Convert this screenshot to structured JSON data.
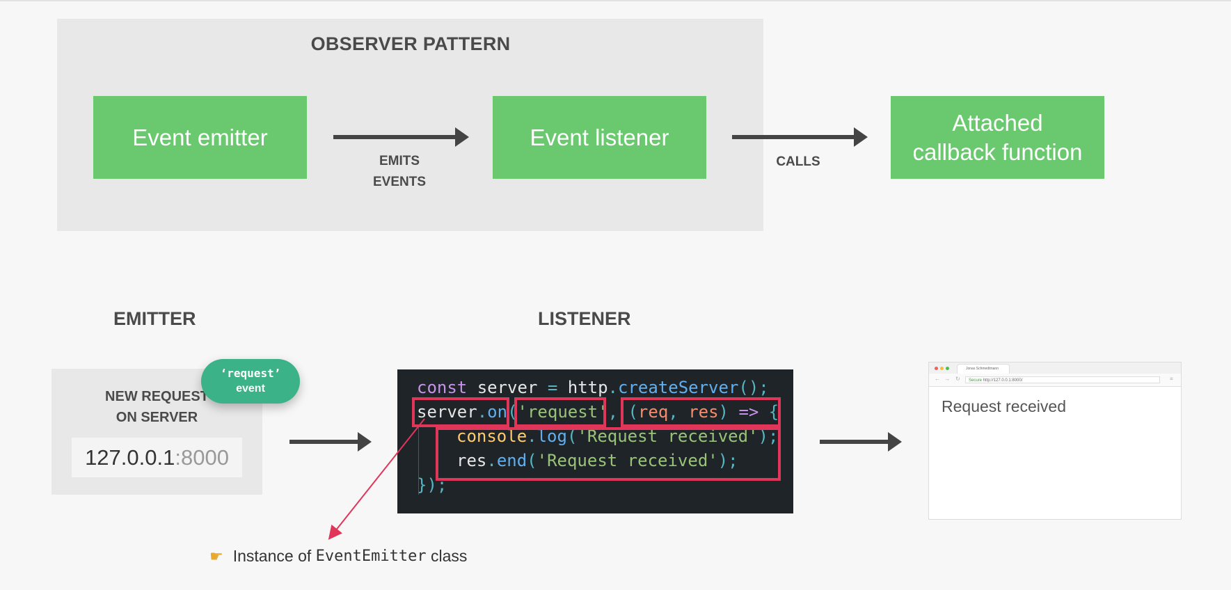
{
  "observer": {
    "title": "OBSERVER PATTERN",
    "emitter_box": "Event emitter",
    "listener_box": "Event listener",
    "callback_box_line1": "Attached",
    "callback_box_line2": "callback function",
    "emits_line1": "EMITS",
    "emits_line2": "EVENTS",
    "calls": "CALLS"
  },
  "emitter": {
    "heading": "EMITTER",
    "text_line1": "NEW REQUEST",
    "text_line2": "ON SERVER",
    "url_host": "127.0.0.1",
    "url_port": ":8000",
    "pill_line1": "‘request’",
    "pill_line2": "event"
  },
  "listener": {
    "heading": "LISTENER"
  },
  "code": {
    "l1_kw": "const",
    "l1_a": " server ",
    "l1_eq": "=",
    "l1_b": " http",
    "l1_dot": ".",
    "l1_fn": "createServer",
    "l1_end": "();",
    "l2_a": "server",
    "l2_dot": ".",
    "l2_fn": "on",
    "l2_p1": "(",
    "l2_str": "'request'",
    "l2_comma": ", ",
    "l2_p2": "(",
    "l2_req": "req",
    "l2_c": ", ",
    "l2_res": "res",
    "l2_p3": ")",
    "l2_arrow": " => ",
    "l2_brace": "{",
    "l3_obj": "console",
    "l3_dot": ".",
    "l3_fn": "log",
    "l3_p1": "(",
    "l3_str": "'Request received'",
    "l3_end": ");",
    "l4_obj": "res",
    "l4_dot": ".",
    "l4_fn": "end",
    "l4_p1": "(",
    "l4_str": "'Request received'",
    "l4_end": ");",
    "l5": "});"
  },
  "browser": {
    "tab_title": "Jonas Schmedtmann",
    "secure": "Secure",
    "url": "http://127.0.0.1:8000/",
    "page_text": "Request received"
  },
  "note": {
    "prefix": "Instance of ",
    "class_name": "EventEmitter",
    "suffix": " class",
    "icon": "pointing-hand-icon"
  },
  "colors": {
    "green_box": "#6ac96f",
    "pill": "#3bb287",
    "highlight": "#e0365a",
    "code_bg": "#1f2428"
  }
}
